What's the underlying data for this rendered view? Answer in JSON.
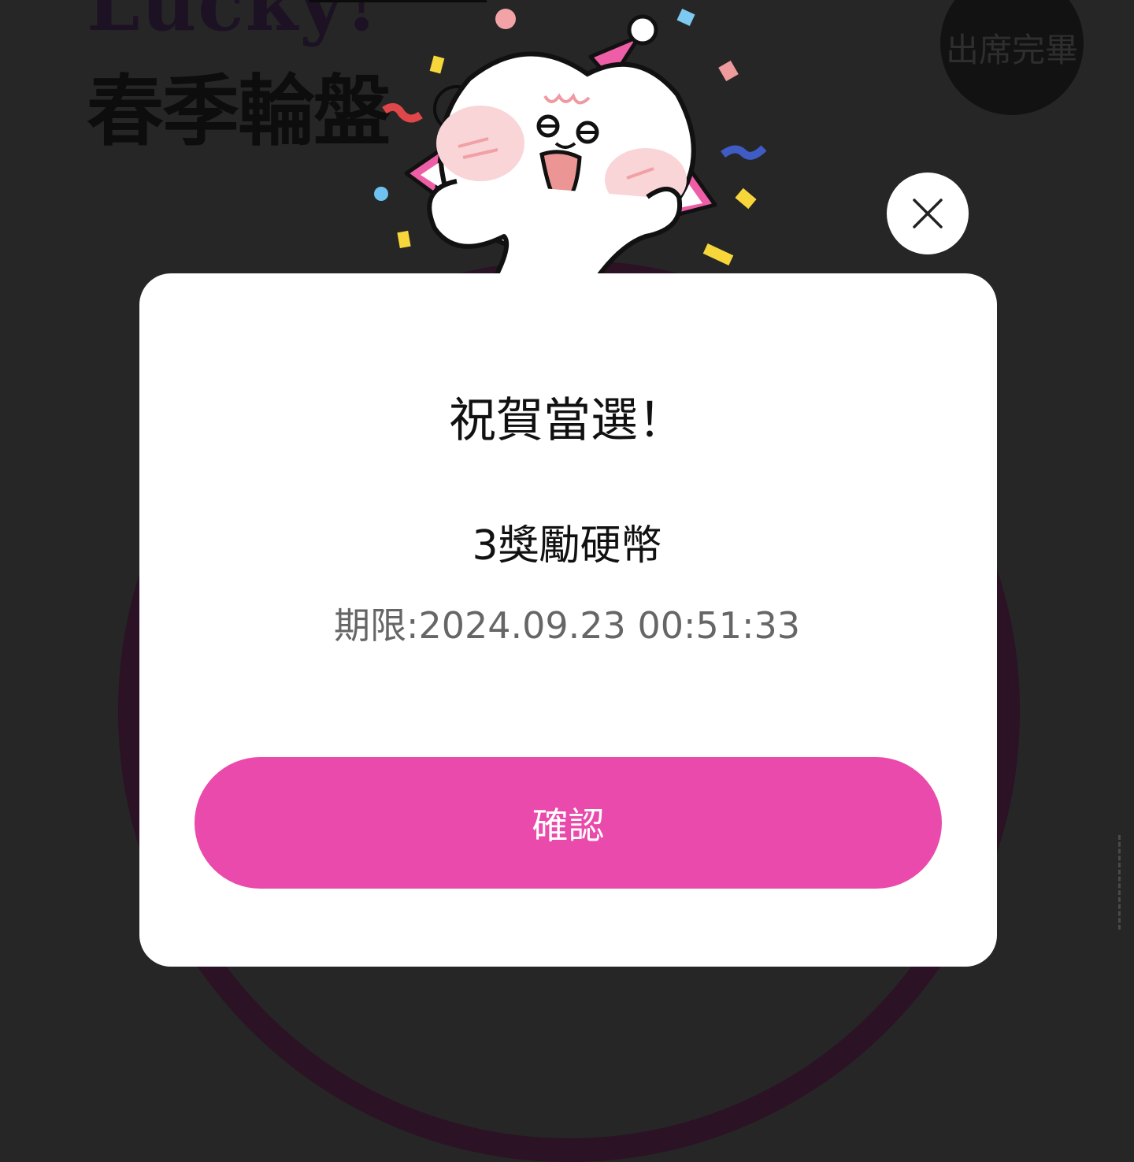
{
  "background": {
    "brand_text": "Lucky!",
    "page_title": "春季輪盤",
    "attendance_badge": "出席完畢"
  },
  "dialog": {
    "title": "祝賀當選！",
    "prize": "3獎勵硬幣",
    "expiry": "期限:2024.09.23 00:51:33",
    "confirm_label": "確認",
    "close_icon": "close-icon"
  },
  "colors": {
    "overlay": "#262626",
    "dialog_bg": "#ffffff",
    "confirm_button": "#ea4aab",
    "expiry_text": "#666666"
  }
}
